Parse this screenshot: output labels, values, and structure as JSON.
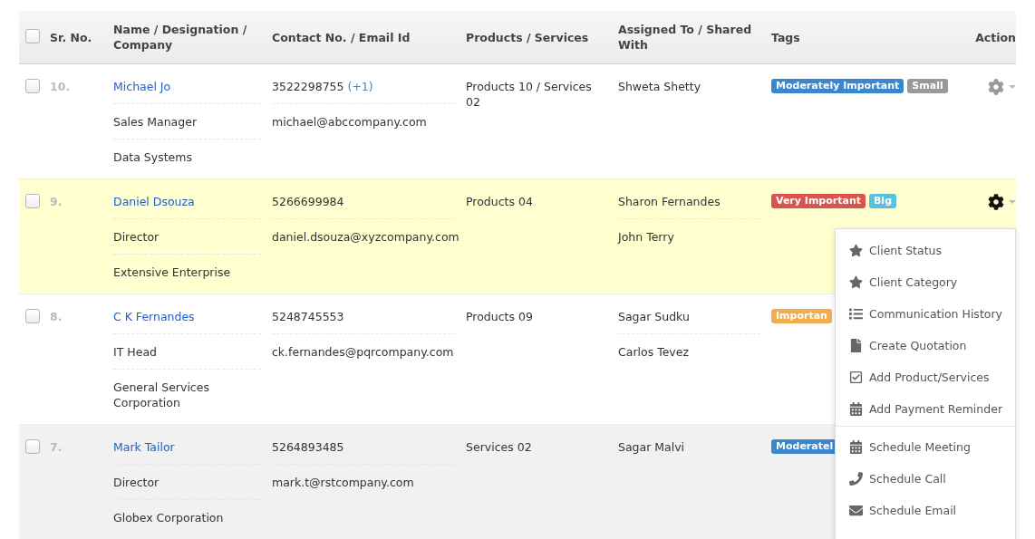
{
  "header": {
    "checked": false,
    "columns": [
      "Sr. No.",
      "Name / Designation / Company",
      "Contact No. / Email Id",
      "Products / Services",
      "Assigned To / Shared With",
      "Tags",
      "Action"
    ]
  },
  "rows": [
    {
      "checked": false,
      "selected": false,
      "hovered": false,
      "action": {
        "menu_open": false
      },
      "sr": "10.",
      "name": "Michael Jo",
      "designation": "Sales Manager",
      "company": "Data Systems",
      "phone": "3522298755",
      "phone_extra": "(+1)",
      "email": "michael@abccompany.com",
      "products": "Products 10 / Services 02",
      "assigned": [
        "Shweta Shetty"
      ],
      "tags": [
        {
          "label": "Moderately Important",
          "color": "#3a87d0"
        },
        {
          "label": "Small",
          "color": "#999999"
        }
      ]
    },
    {
      "checked": false,
      "selected": true,
      "hovered": false,
      "action": {
        "menu_open": true
      },
      "sr": "9.",
      "name": "Daniel Dsouza",
      "designation": "Director",
      "company": "Extensive Enterprise",
      "phone": "5266699984",
      "email": "daniel.dsouza@xyzcompany.com",
      "products": "Products 04",
      "assigned": [
        "Sharon Fernandes",
        "John Terry"
      ],
      "tags": [
        {
          "label": "Very Important",
          "color": "#d9534f"
        },
        {
          "label": "Big",
          "color": "#5bc0de"
        }
      ]
    },
    {
      "checked": false,
      "selected": false,
      "hovered": false,
      "sr": "8.",
      "name": "C K Fernandes",
      "designation": "IT Head",
      "company": "General Services Corporation",
      "phone": "5248745553",
      "email": "ck.fernandes@pqrcompany.com",
      "products": "Products 09",
      "assigned": [
        "Sagar Sudku",
        "Carlos Tevez"
      ],
      "tags": [
        {
          "label": "Importan",
          "color": "#f0ad4e"
        }
      ]
    },
    {
      "checked": false,
      "selected": false,
      "hovered": true,
      "sr": "7.",
      "name": "Mark Tailor",
      "designation": "Director",
      "company": "Globex Corporation",
      "phone": "5264893485",
      "email": "mark.t@rstcompany.com",
      "products": "Services 02",
      "assigned": [
        "Sagar Malvi"
      ],
      "tags": [
        {
          "label": "Moderatel",
          "color": "#3a87d0"
        }
      ]
    }
  ],
  "action_menu": {
    "groups": [
      [
        {
          "kind": "star",
          "label": "Client Status"
        },
        {
          "kind": "star",
          "label": "Client Category"
        },
        {
          "kind": "list",
          "label": "Communication History"
        },
        {
          "kind": "file",
          "label": "Create Quotation"
        },
        {
          "kind": "check",
          "label": "Add Product/Services"
        },
        {
          "kind": "calendar",
          "label": "Add Payment Reminder"
        }
      ],
      [
        {
          "kind": "calendar",
          "label": "Schedule Meeting"
        },
        {
          "kind": "phone",
          "label": "Schedule Call"
        },
        {
          "kind": "envelope",
          "label": "Schedule Email"
        }
      ]
    ]
  }
}
